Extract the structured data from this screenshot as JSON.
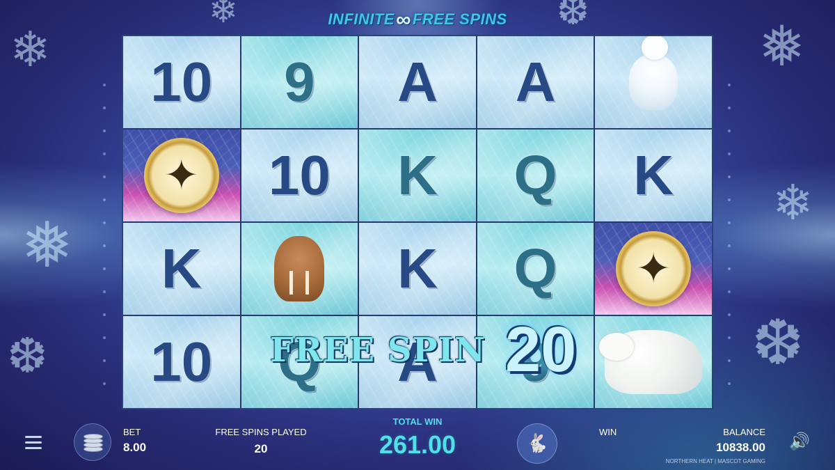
{
  "title": {
    "left": "INFINITE",
    "symbol": "∞",
    "right": "FREE SPINS"
  },
  "reels": [
    [
      {
        "sym": "10"
      },
      {
        "sym": "9",
        "teal": true
      },
      {
        "sym": "A"
      },
      {
        "sym": "A"
      },
      {
        "img": "arctic-fox"
      }
    ],
    [
      {
        "img": "compass"
      },
      {
        "sym": "10"
      },
      {
        "sym": "K",
        "teal": true
      },
      {
        "sym": "Q",
        "teal": true
      },
      {
        "sym": "K"
      }
    ],
    [
      {
        "sym": "K"
      },
      {
        "img": "walrus"
      },
      {
        "sym": "K"
      },
      {
        "sym": "Q",
        "teal": true
      },
      {
        "img": "compass"
      }
    ],
    [
      {
        "sym": "10"
      },
      {
        "sym": "Q",
        "teal": true
      },
      {
        "sym": "A"
      },
      {
        "sym": "9",
        "teal": true
      },
      {
        "img": "polar-bear"
      }
    ]
  ],
  "overlay": {
    "text": "FREE SPIN",
    "count": "20"
  },
  "bet": {
    "label": "BET",
    "value": "8.00"
  },
  "free_spins": {
    "label": "FREE SPINS PLAYED",
    "value": "20"
  },
  "total_win": {
    "label": "TOTAL WIN",
    "value": "261.00"
  },
  "win": {
    "label": "WIN",
    "value": ""
  },
  "balance": {
    "label": "BALANCE",
    "value": "10838.00"
  },
  "credit": "NORTHERN HEAT | MASCOT GAMING",
  "icons": {
    "menu": "hamburger-icon",
    "coins": "coin-stack-icon",
    "turbo": "rabbit-icon",
    "sound": "speaker-icon"
  },
  "colors": {
    "accent": "#4fe0e8",
    "symbol": "#274a85"
  }
}
